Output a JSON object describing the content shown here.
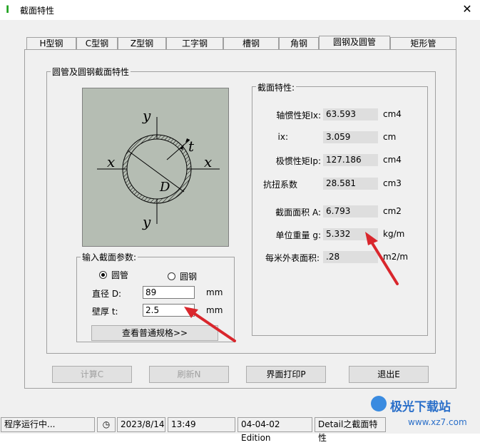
{
  "window": {
    "title": "截面特性"
  },
  "tabs": [
    "H型钢",
    "C型钢",
    "Z型钢",
    "工字钢",
    "槽钢",
    "角钢",
    "圆钢及圆管",
    "矩形管"
  ],
  "active_tab": "圆钢及圆管",
  "left_group": {
    "title": "圆管及圆钢截面特性"
  },
  "figure": {
    "label_y": "y",
    "label_x": "x",
    "label_t": "t",
    "label_D": "D"
  },
  "input_group": {
    "title": "输入截面参数:",
    "radio_pipe": "圆管",
    "radio_bar": "圆钢",
    "selected": "圆管",
    "diameter_label": "直径 D:",
    "diameter_value": "89",
    "diameter_unit": "mm",
    "thickness_label": "壁厚 t:",
    "thickness_value": "2.5",
    "thickness_unit": "mm",
    "view_button": "查看普通规格>>"
  },
  "props_group": {
    "title": "截面特性:",
    "rows": [
      {
        "label": "轴惯性矩Ix:",
        "value": "63.593",
        "unit": "cm4"
      },
      {
        "label": "ix:",
        "value": "3.059",
        "unit": "cm"
      },
      {
        "label": "极惯性矩Ip:",
        "value": "127.186",
        "unit": "cm4"
      },
      {
        "label": "抗扭系数",
        "value": "28.581",
        "unit": "cm3"
      },
      {
        "label": "截面面积 A:",
        "value": "6.793",
        "unit": "cm2"
      },
      {
        "label": "单位重量 g:",
        "value": "5.332",
        "unit": "kg/m"
      },
      {
        "label": "每米外表面积:",
        "value": ".28",
        "unit": "m2/m"
      }
    ]
  },
  "buttons": {
    "calc": "计算C",
    "refresh": "刷新N",
    "print": "界面打印P",
    "exit": "退出E"
  },
  "status": {
    "running": "程序运行中...",
    "date": "2023/8/14",
    "time": "13:49",
    "edition": "04-04-02 Edition",
    "module": "Detail之截面特性"
  },
  "watermark": {
    "text": "极光下载站",
    "url": "www.xz7.com"
  },
  "colors": {
    "accent_arrow": "#d9262c",
    "figure_bg": "#b5bdb3"
  }
}
